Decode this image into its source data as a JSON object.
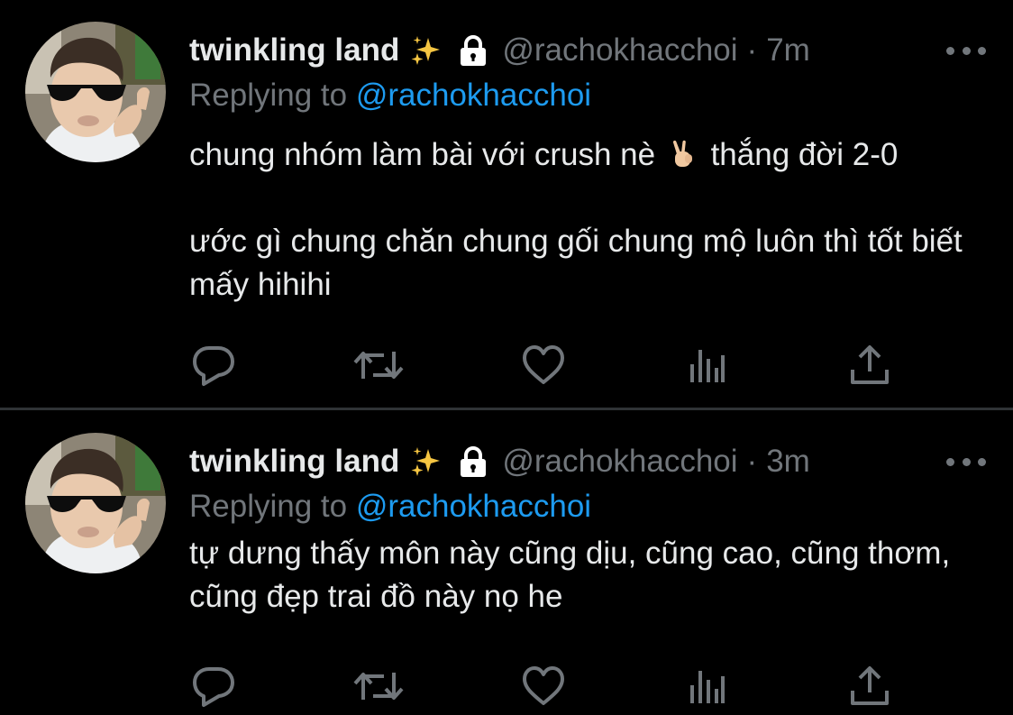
{
  "colors": {
    "background": "#000000",
    "primary_text": "#e7e9ea",
    "secondary_text": "#71767b",
    "link": "#1d9bf0",
    "divider": "#2f3336",
    "sparkle": "#f5c542"
  },
  "tweets": [
    {
      "display_name": "twinkling land",
      "handle": "@rachokhacchoi",
      "separator": "·",
      "time": "7m",
      "replying_prefix": "Replying to",
      "replying_handle": "@rachokhacchoi",
      "body_line1_before_emoji": "chung nhóm làm bài với crush nè",
      "body_line1_after_emoji": "thắng đời 2-0",
      "body_paragraph2": "ước gì chung chăn chung gối chung mộ luôn thì tốt biết mấy hihihi",
      "icons": [
        "sparkles-icon",
        "lock-icon",
        "more-icon",
        "victory-hand-icon",
        "reply-icon",
        "retweet-icon",
        "like-icon",
        "views-icon",
        "share-icon"
      ]
    },
    {
      "display_name": "twinkling land",
      "handle": "@rachokhacchoi",
      "separator": "·",
      "time": "3m",
      "replying_prefix": "Replying to",
      "replying_handle": "@rachokhacchoi",
      "body_paragraph1": "tự dưng thấy môn này cũng dịu, cũng cao, cũng thơm, cũng đẹp trai đồ này nọ he",
      "icons": [
        "sparkles-icon",
        "lock-icon",
        "more-icon",
        "reply-icon",
        "retweet-icon",
        "like-icon",
        "views-icon",
        "share-icon"
      ]
    }
  ]
}
